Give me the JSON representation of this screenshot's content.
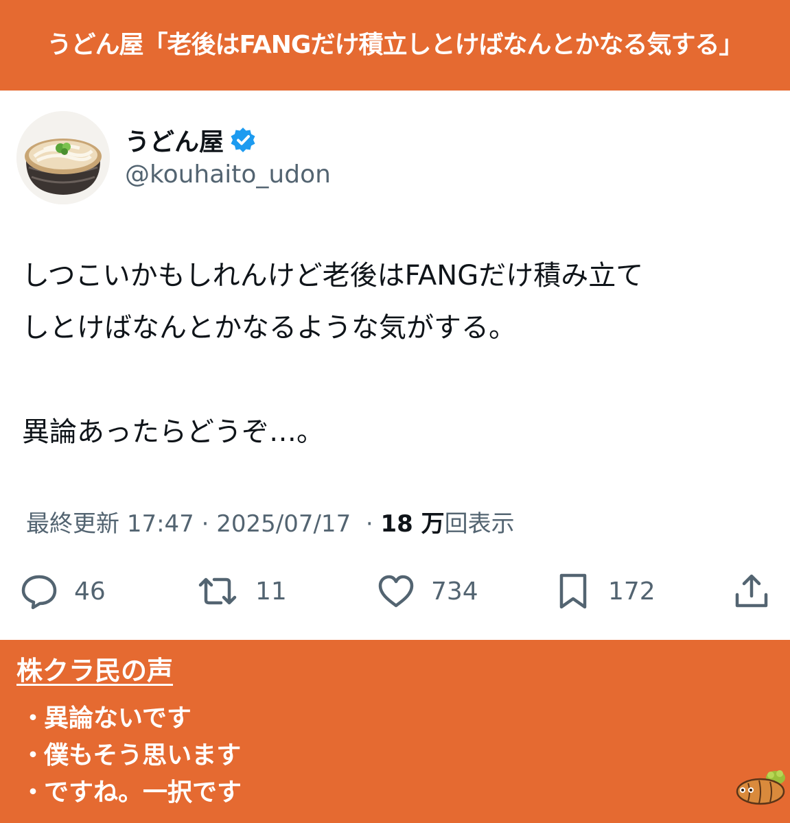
{
  "banner": {
    "title": "うどん屋「老後はFANGだけ積立しとけばなんとかなる気する」"
  },
  "tweet": {
    "display_name": "うどん屋",
    "handle": "@kouhaito_udon",
    "body_lines": [
      "しつこいかもしれんけど老後はFANGだけ積み立て",
      "しとけばなんとかなるような気がする。",
      "",
      "異論あったらどうぞ…。"
    ],
    "meta": {
      "updated_prefix": "最終更新",
      "time": "17:47",
      "date": "2025/07/17",
      "views_count": "18 万",
      "views_label": "回表示"
    },
    "actions": {
      "replies": "46",
      "retweets": "11",
      "likes": "734",
      "bookmarks": "172"
    }
  },
  "voices": {
    "heading": "株クラ民の声",
    "items": [
      "異論ないです",
      "僕もそう思います",
      "ですね。一択です"
    ]
  },
  "icons": {
    "reply": "speech-bubble-icon",
    "retweet": "retweet-icon",
    "like": "heart-icon",
    "bookmark": "bookmark-icon",
    "share": "share-icon",
    "verified": "verified-badge-icon"
  },
  "colors": {
    "banner_bg": "#e56a31",
    "verified_blue": "#1d9bf0",
    "muted_text": "#536471",
    "main_text": "#0f1419"
  }
}
